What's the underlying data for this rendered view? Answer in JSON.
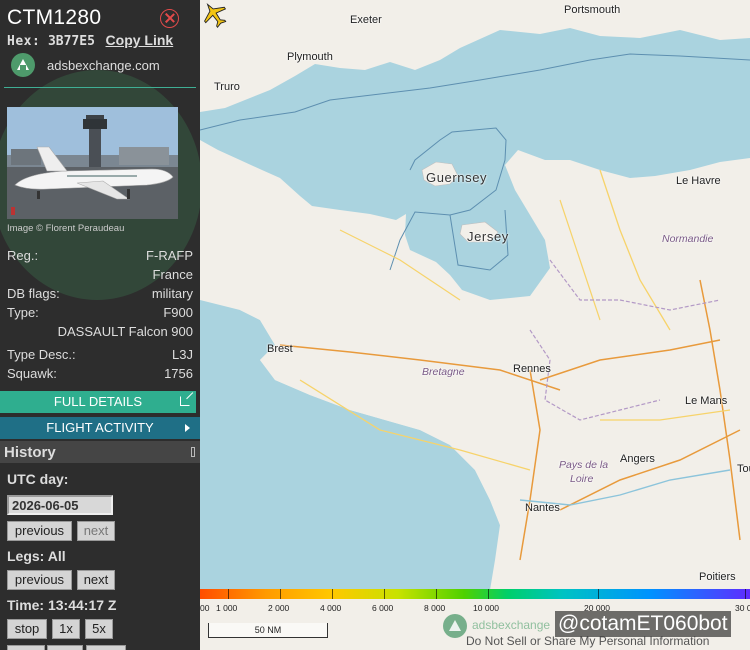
{
  "aircraft": {
    "callsign": "CTM1280",
    "hex_label": "Hex:",
    "hex": "3B77E5",
    "copy_link": "Copy Link",
    "brand": "adsbexchange.com",
    "photo_credit": "Image © Florent Peraudeau",
    "info": [
      {
        "key": "Reg.:",
        "value": "F-RAFP"
      },
      {
        "key": "",
        "value": "France"
      },
      {
        "key": "DB flags:",
        "value": "military"
      },
      {
        "key": "Type:",
        "value": "F900"
      },
      {
        "key": "",
        "value": "DASSAULT Falcon 900"
      },
      {
        "key": "Type Desc.:",
        "value": "L3J"
      },
      {
        "key": "Squawk:",
        "value": "1756"
      }
    ]
  },
  "actions": {
    "full_details": "FULL DETAILS",
    "flight_activity": "FLIGHT ACTIVITY"
  },
  "history": {
    "title": "History",
    "utc_day_label": "UTC day:",
    "date": "2026-06-05",
    "day_prev": "previous",
    "day_next": "next",
    "legs_label": "Legs: All",
    "legs_prev": "previous",
    "legs_next": "next",
    "time_label": "Time: 13:44:17 Z",
    "stop": "stop",
    "speed_1x": "1x",
    "speed_5x": "5x"
  },
  "map": {
    "places": {
      "portsmouth": "Portsmouth",
      "exeter": "Exeter",
      "plymouth": "Plymouth",
      "truro": "Truro",
      "le_havre": "Le Havre",
      "rennes": "Rennes",
      "brest": "Brest",
      "le_mans": "Le Mans",
      "angers": "Angers",
      "nantes": "Nantes",
      "poitiers": "Poitiers",
      "tours": "Tou"
    },
    "islands": {
      "guernsey": "Guernsey",
      "jersey": "Jersey"
    },
    "regions": {
      "normandie": "Normandie",
      "bretagne": "Bretagne",
      "pays_de_la_loire_1": "Pays de la",
      "pays_de_la_loire_2": "Loire"
    },
    "altitude_ticks": [
      "00",
      "1 000",
      "2 000",
      "4 000",
      "6 000",
      "8 000",
      "10 000",
      "20 000",
      "30 0"
    ],
    "scale": "50 NM",
    "brand": "adsbexchange",
    "bot_tag": "@cotamET060bot",
    "do_not_sell": "Do Not Sell or Share My Personal Information"
  },
  "colors": {
    "sidebar_bg": "#2d2d2d",
    "full_details_bg": "#2fae8f",
    "flight_activity_bg": "#1f6f86",
    "aircraft_icon": "#f2c414",
    "sea": "#aad3df",
    "land": "#f2efe9"
  },
  "icons": [
    "close-icon",
    "adsbx-logo-icon",
    "external-link-icon",
    "chevron-right-icon",
    "aircraft-icon"
  ]
}
